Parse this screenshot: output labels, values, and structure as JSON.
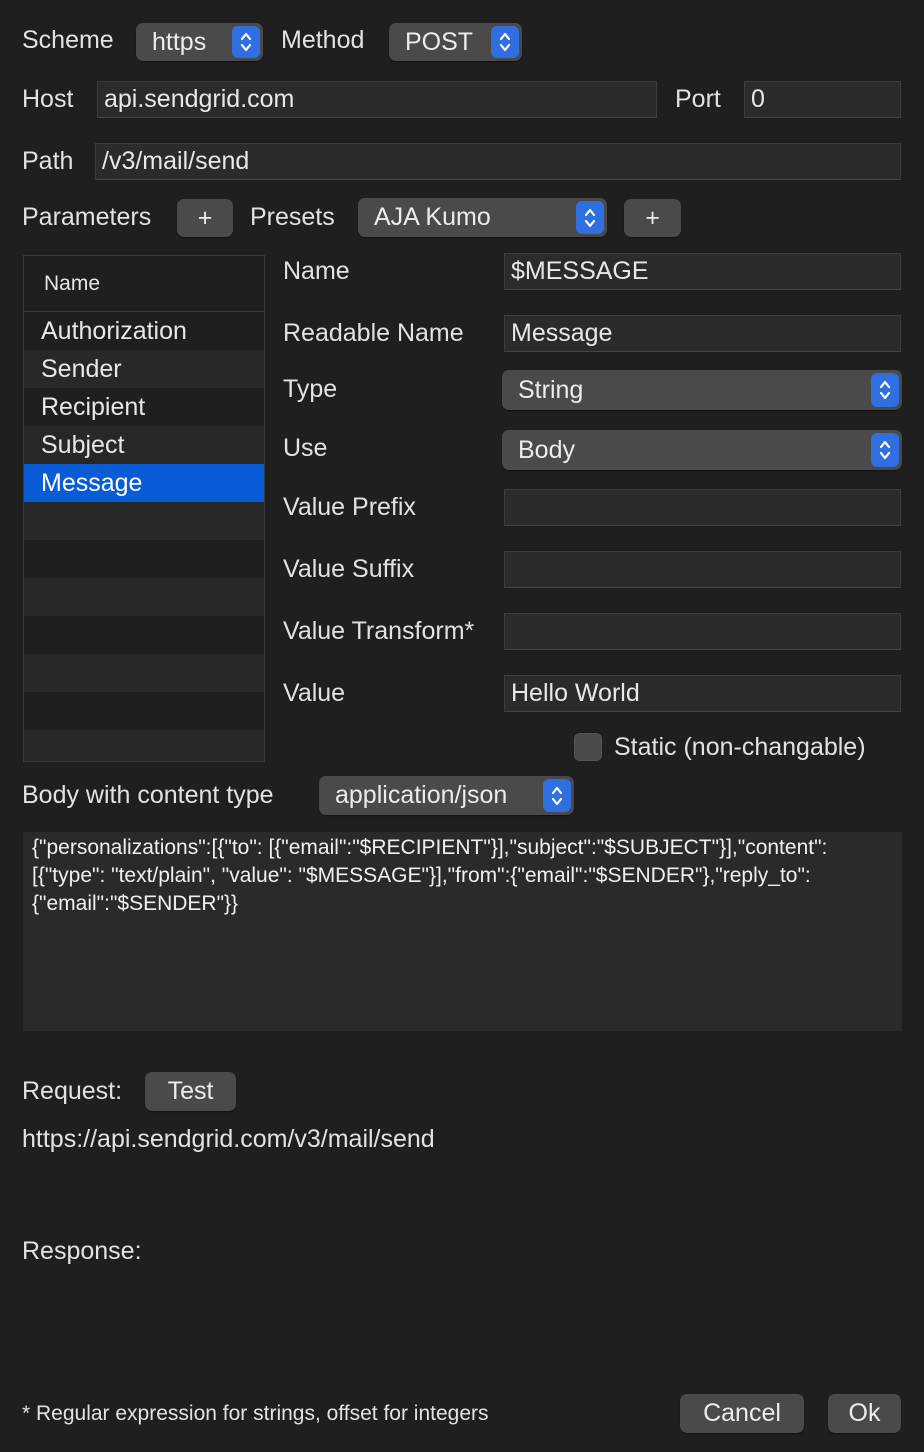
{
  "request": {
    "scheme_label": "Scheme",
    "scheme_value": "https",
    "method_label": "Method",
    "method_value": "POST",
    "host_label": "Host",
    "host_value": "api.sendgrid.com",
    "port_label": "Port",
    "port_value": "0",
    "path_label": "Path",
    "path_value": "/v3/mail/send"
  },
  "params": {
    "label": "Parameters",
    "add_label": "+",
    "presets_label": "Presets",
    "presets_value": "AJA Kumo",
    "presets_add_label": "+",
    "table_header": "Name",
    "items": [
      "Authorization",
      "Sender",
      "Recipient",
      "Subject",
      "Message"
    ],
    "selected": "Message"
  },
  "detail": {
    "name_label": "Name",
    "name_value": "$MESSAGE",
    "readable_label": "Readable Name",
    "readable_value": "Message",
    "type_label": "Type",
    "type_value": "String",
    "use_label": "Use",
    "use_value": "Body",
    "prefix_label": "Value Prefix",
    "prefix_value": "",
    "suffix_label": "Value Suffix",
    "suffix_value": "",
    "transform_label": "Value Transform*",
    "transform_value": "",
    "value_label": "Value",
    "value_value": "Hello World",
    "static_label": "Static (non-changable)"
  },
  "body": {
    "label": "Body with content type",
    "content_type": "application/json",
    "text": "{\"personalizations\":[{\"to\": [{\"email\":\"$RECIPIENT\"}],\"subject\":\"$SUBJECT\"}],\"content\": [{\"type\": \"text/plain\", \"value\": \"$MESSAGE\"}],\"from\":{\"email\":\"$SENDER\"},\"reply_to\": {\"email\":\"$SENDER\"}}"
  },
  "test": {
    "request_label": "Request:",
    "test_button": "Test",
    "url": "https://api.sendgrid.com/v3/mail/send",
    "response_label": "Response:"
  },
  "footer": {
    "note": "* Regular expression for strings, offset for integers",
    "cancel_label": "Cancel",
    "ok_label": "Ok"
  },
  "colors": {
    "accent": "#0a5bd6",
    "stepper": "#2f6fe0",
    "background": "#1f1f1f"
  }
}
